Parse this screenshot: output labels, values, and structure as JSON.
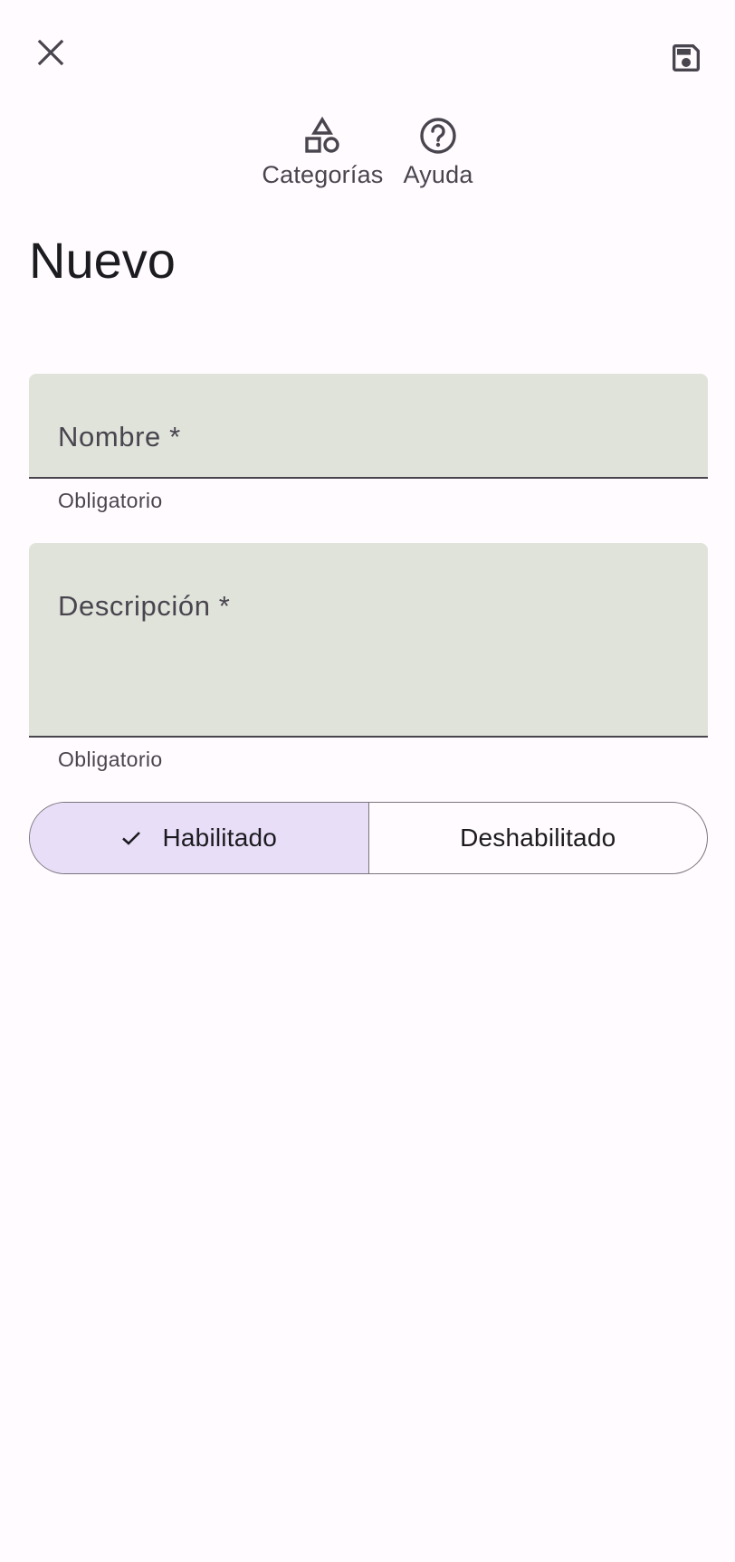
{
  "toolbar": {
    "close_icon": "close-icon",
    "save_icon": "save-icon"
  },
  "nav_actions": [
    {
      "label": "Categorías",
      "icon": "categories-icon"
    },
    {
      "label": "Ayuda",
      "icon": "help-icon"
    }
  ],
  "page": {
    "title": "Nuevo"
  },
  "form": {
    "name_field": {
      "label": "Nombre *",
      "value": "",
      "helper": "Obligatorio"
    },
    "description_field": {
      "label": "Descripción *",
      "value": "",
      "helper": "Obligatorio"
    },
    "status_toggle": {
      "options": [
        "Habilitado",
        "Deshabilitado"
      ],
      "selected": "Habilitado"
    }
  },
  "colors": {
    "background": "#fffbfe",
    "field_fill": "#e0e3da",
    "selected_segment": "#e8def8",
    "outline": "#79747e",
    "on_surface": "#1c1b1f",
    "on_surface_variant": "#49454f"
  }
}
